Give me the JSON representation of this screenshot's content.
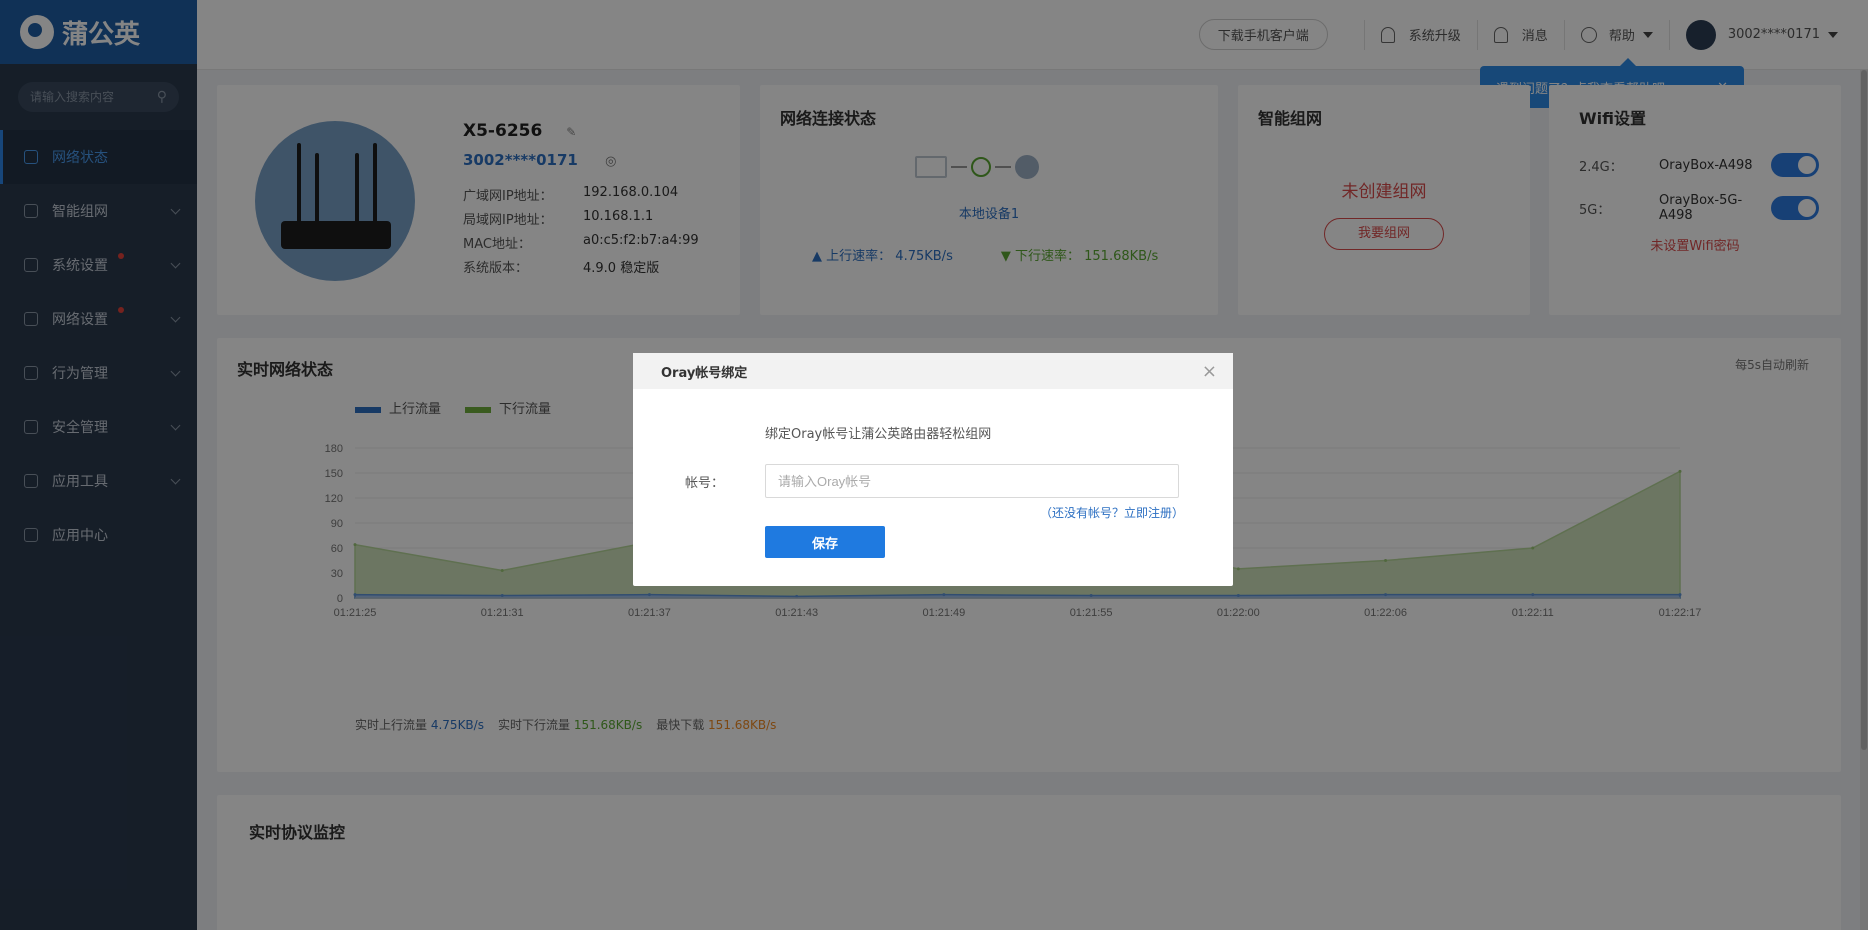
{
  "brand": {
    "name": "蒲公英"
  },
  "sidebar": {
    "search_placeholder": "请输入搜索内容",
    "items": [
      {
        "label": "网络状态",
        "active": true
      },
      {
        "label": "智能组网"
      },
      {
        "label": "系统设置",
        "badge": true
      },
      {
        "label": "网络设置",
        "badge": true
      },
      {
        "label": "行为管理"
      },
      {
        "label": "安全管理"
      },
      {
        "label": "应用工具"
      },
      {
        "label": "应用中心"
      }
    ]
  },
  "topbar": {
    "download": "下载手机客户端",
    "upgrade": "系统升级",
    "messages": "消息",
    "help": "帮助",
    "account": "3002****0171",
    "help_tip": "遇到问题了？点我查看帮助吧~"
  },
  "device": {
    "name": "X5-6256",
    "id": "3002****0171",
    "rows": [
      {
        "k": "广域网IP地址：",
        "v": "192.168.0.104"
      },
      {
        "k": "局域网IP地址：",
        "v": "10.168.1.1"
      },
      {
        "k": "MAC地址：",
        "v": "a0:c5:f2:b7:a4:99"
      },
      {
        "k": "系统版本：",
        "v": "4.9.0 稳定版"
      }
    ]
  },
  "netstat": {
    "title": "网络连接状态",
    "local": "本地设备1",
    "up_label": "上行速率：",
    "up_value": "4.75KB/s",
    "down_label": "下行速率：",
    "down_value": "151.68KB/s"
  },
  "mesh": {
    "title": "智能组网",
    "warning": "未创建组网",
    "button": "我要组网"
  },
  "wifi": {
    "title": "Wifi设置",
    "rows": [
      {
        "band": "2.4G：",
        "ssid": "OrayBox-A498",
        "on": true
      },
      {
        "band": "5G：",
        "ssid": "OrayBox-5G-A498",
        "on": true
      }
    ],
    "no_password": "未设置Wifi密码"
  },
  "traffic": {
    "title": "实时网络状态",
    "refresh": "每5s自动刷新",
    "legend_up": "上行流量",
    "legend_down": "下行流量",
    "stats": {
      "up_label": "实时上行流量",
      "up_value": "4.75KB/s",
      "down_label": "实时下行流量",
      "down_value": "151.68KB/s",
      "peak_label": "最快下载",
      "peak_value": "151.68KB/s"
    }
  },
  "chart_data": {
    "type": "area",
    "x": [
      "01:21:25",
      "01:21:31",
      "01:21:37",
      "01:21:43",
      "01:21:49",
      "01:21:55",
      "01:22:00",
      "01:22:06",
      "01:22:11",
      "01:22:17"
    ],
    "yticks": [
      0,
      30,
      60,
      90,
      120,
      150,
      180
    ],
    "ylim": [
      0,
      180
    ],
    "series": [
      {
        "name": "上行流量",
        "color": "#2c6fc2",
        "values": [
          4,
          3,
          4,
          2,
          4,
          3,
          3,
          4,
          4,
          4
        ]
      },
      {
        "name": "下行流量",
        "color": "#6fae3c",
        "values": [
          64,
          33,
          67,
          17,
          68,
          70,
          35,
          45,
          60,
          152
        ]
      }
    ]
  },
  "proto": {
    "title": "实时协议监控"
  },
  "modal": {
    "title": "Oray帐号绑定",
    "close": "×",
    "description": "绑定Oray帐号让蒲公英路由器轻松组网",
    "account_label": "帐号：",
    "account_placeholder": "请输入Oray帐号",
    "register_link": "（还没有帐号？立即注册）",
    "save": "保存"
  }
}
